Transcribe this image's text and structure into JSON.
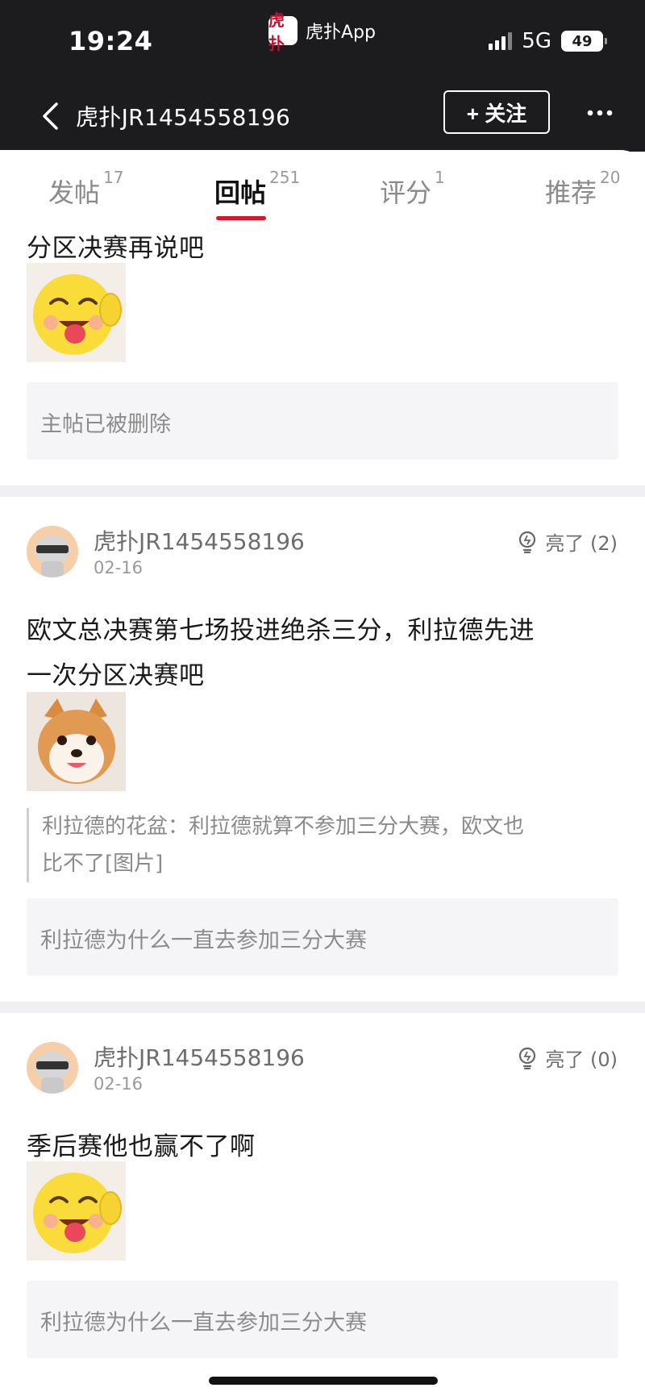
{
  "status_bar": {
    "time": "19:24",
    "app_logo_text": "虎扑",
    "app_name": "虎扑App",
    "network": "5G",
    "battery": "49"
  },
  "nav": {
    "title": "虎扑JR1454558196",
    "follow_label": "+ 关注"
  },
  "tabs": [
    {
      "label": "发帖",
      "count": "17"
    },
    {
      "label": "回帖",
      "count": "251",
      "active": true
    },
    {
      "label": "评分",
      "count": "1"
    },
    {
      "label": "推荐",
      "count": "20"
    }
  ],
  "posts": [
    {
      "body": "分区决赛再说吧",
      "sticker": "laughing-emoji-sticker",
      "quote_box": "主帖已被删除"
    },
    {
      "username": "虎扑JR1454558196",
      "date": "02-16",
      "like_label": "亮了 (2)",
      "body_line1": "欧文总决赛第七场投进绝杀三分，利拉德先进",
      "body_line2": "一次分区决赛吧",
      "sticker": "shiba-dog-sticker",
      "reply_line1": "利拉德的花盆：利拉德就算不参加三分大赛，欧文也",
      "reply_line2": "比不了[图片]",
      "quote_box": "利拉德为什么一直去参加三分大赛"
    },
    {
      "username": "虎扑JR1454558196",
      "date": "02-16",
      "like_label": "亮了 (0)",
      "body": "季后赛他也赢不了啊",
      "sticker": "laughing-emoji-sticker",
      "quote_box": "利拉德为什么一直去参加三分大赛"
    }
  ],
  "colors": {
    "accent": "#d7162c",
    "topbar": "#1c1c1e",
    "quote_bg": "#f5f5f7"
  }
}
